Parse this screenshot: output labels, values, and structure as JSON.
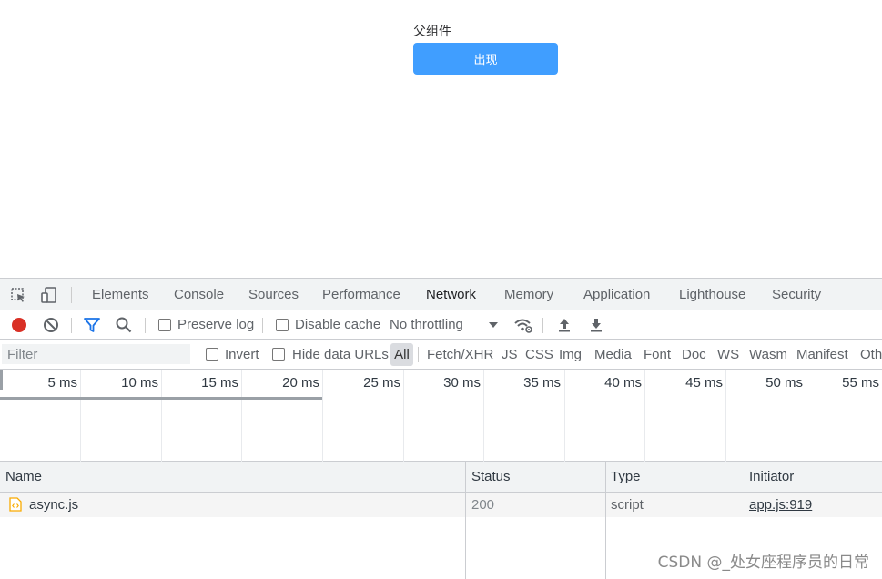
{
  "page": {
    "parent_label": "父组件",
    "show_button": "出现"
  },
  "devtools": {
    "tabs": [
      {
        "label": "Elements"
      },
      {
        "label": "Console"
      },
      {
        "label": "Sources"
      },
      {
        "label": "Performance"
      },
      {
        "label": "Network",
        "active": true
      },
      {
        "label": "Memory"
      },
      {
        "label": "Application"
      },
      {
        "label": "Lighthouse"
      },
      {
        "label": "Security"
      }
    ],
    "toolbar": {
      "preserve_log": "Preserve log",
      "disable_cache": "Disable cache",
      "throttling": "No throttling"
    },
    "filter": {
      "placeholder": "Filter",
      "invert": "Invert",
      "hide_data_urls": "Hide data URLs",
      "types": [
        "All",
        "Fetch/XHR",
        "JS",
        "CSS",
        "Img",
        "Media",
        "Font",
        "Doc",
        "WS",
        "Wasm",
        "Manifest",
        "Oth"
      ]
    },
    "timeline": {
      "ticks": [
        "5 ms",
        "10 ms",
        "15 ms",
        "20 ms",
        "25 ms",
        "30 ms",
        "35 ms",
        "40 ms",
        "45 ms",
        "50 ms",
        "55 ms"
      ]
    },
    "table": {
      "headers": {
        "name": "Name",
        "status": "Status",
        "type": "Type",
        "initiator": "Initiator"
      },
      "rows": [
        {
          "name": "async.js",
          "status": "200",
          "type": "script",
          "initiator": "app.js:919"
        }
      ]
    },
    "colors": {
      "record": "#d93025",
      "accent": "#1a73e8",
      "button": "#409eff",
      "file_icon": "#f9ab00"
    }
  },
  "watermark": "CSDN @_处女座程序员的日常"
}
